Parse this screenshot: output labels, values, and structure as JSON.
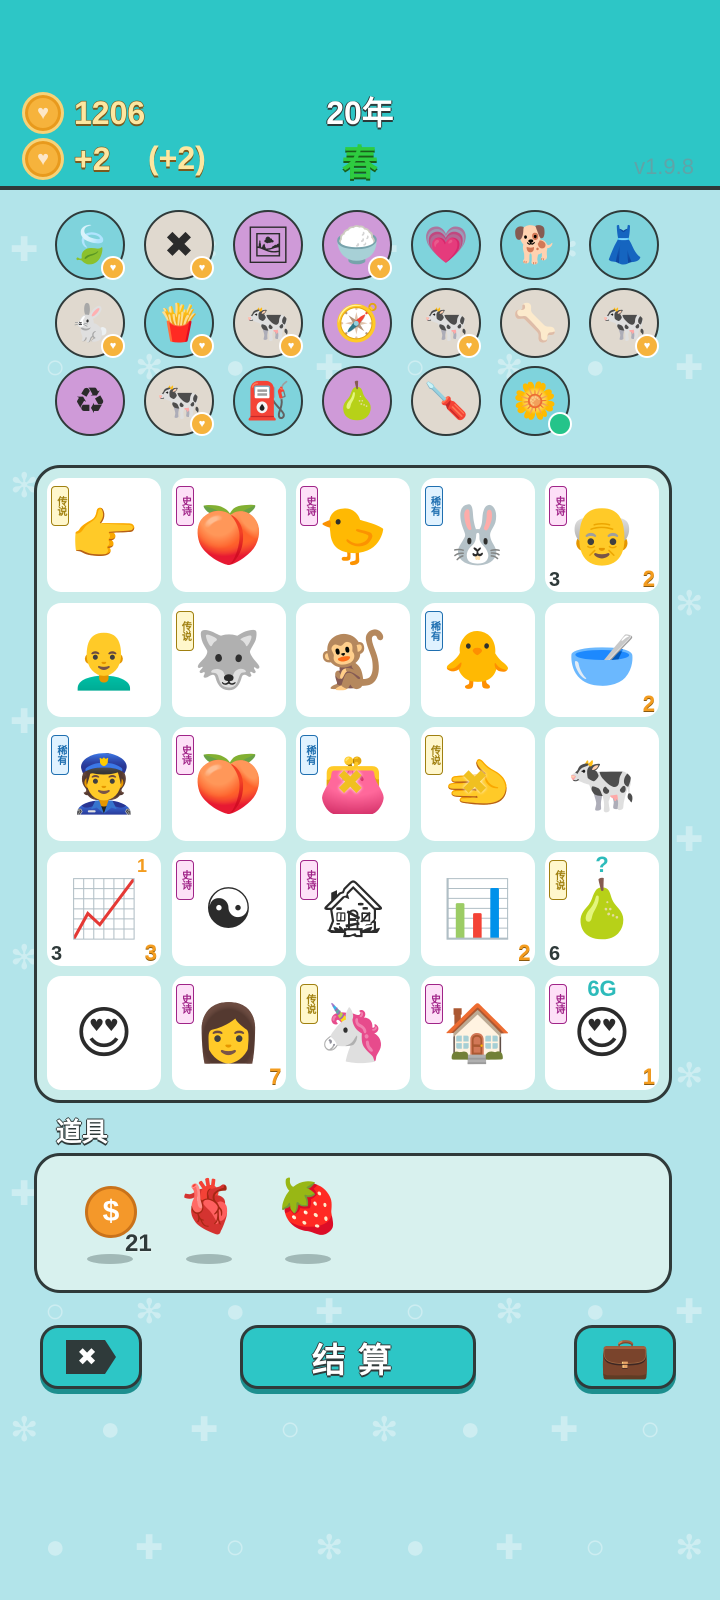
{
  "header": {
    "coins": "1206",
    "income": "+2",
    "income_bonus": "(+2)",
    "year": "20年",
    "season": "春",
    "version": "v1.9.8"
  },
  "relics": [
    {
      "icon": "leaf-icon",
      "glyph": "🍃",
      "bg": "#7fd3dc",
      "badge": true
    },
    {
      "icon": "delete-tag-icon",
      "glyph": "✖",
      "bg": "#e0d9cf",
      "badge": true
    },
    {
      "icon": "time-magazine-icon",
      "glyph": "🖼",
      "bg": "#cf9ad8",
      "badge": false
    },
    {
      "icon": "rice-bowl-icon",
      "glyph": "🍚",
      "bg": "#cf9ad8",
      "badge": true
    },
    {
      "icon": "heart-fan-icon",
      "glyph": "💗",
      "bg": "#7fd3dc",
      "badge": false
    },
    {
      "icon": "cool-dog-icon",
      "glyph": "🐕",
      "bg": "#7fd3dc",
      "badge": false
    },
    {
      "icon": "skirt-icon",
      "glyph": "👗",
      "bg": "#7fd3dc",
      "badge": false
    },
    {
      "icon": "rabbit-icon",
      "glyph": "🐇",
      "bg": "#e0d9cf",
      "badge": true
    },
    {
      "icon": "fries-icon",
      "glyph": "🍟",
      "bg": "#7fd3dc",
      "badge": true
    },
    {
      "icon": "cow-pair-icon",
      "glyph": "🐄",
      "bg": "#e0d9cf",
      "badge": true
    },
    {
      "icon": "compass-icon",
      "glyph": "🧭",
      "bg": "#cf9ad8",
      "badge": false
    },
    {
      "icon": "cow-pair-icon",
      "glyph": "🐄",
      "bg": "#e0d9cf",
      "badge": true
    },
    {
      "icon": "dog-bowl-icon",
      "glyph": "🦴",
      "bg": "#e0d9cf",
      "badge": false
    },
    {
      "icon": "cow-pair-icon",
      "glyph": "🐄",
      "bg": "#e0d9cf",
      "badge": true
    },
    {
      "icon": "recycle-icon",
      "glyph": "♻",
      "bg": "#cf9ad8",
      "badge": false
    },
    {
      "icon": "cow-pair-icon",
      "glyph": "🐄",
      "bg": "#e0d9cf",
      "badge": true
    },
    {
      "icon": "air-pump-icon",
      "glyph": "⛽",
      "bg": "#7fd3dc",
      "badge": false
    },
    {
      "icon": "pear-fruit-icon",
      "glyph": "🍐",
      "bg": "#cf9ad8",
      "badge": false
    },
    {
      "icon": "screwdriver-icon",
      "glyph": "🪛",
      "bg": "#e0d9cf",
      "badge": false
    },
    {
      "icon": "flower-pot-icon",
      "glyph": "🌼",
      "bg": "#7fd3dc",
      "badge": false,
      "dot": true
    }
  ],
  "rarity_labels": {
    "legend": "传说",
    "epic": "史诗",
    "rare": "稀有"
  },
  "board": [
    {
      "icon": "pointing-hand-icon",
      "glyph": "👉",
      "tag": "legend"
    },
    {
      "icon": "peach-icon",
      "glyph": "🍑",
      "tag": "epic"
    },
    {
      "icon": "yellow-chick-face-icon",
      "glyph": "🐤",
      "tag": "epic"
    },
    {
      "icon": "rabbit-icon",
      "glyph": "🐰",
      "tag": "rare"
    },
    {
      "icon": "grandpa-icon",
      "glyph": "👴",
      "tag": "epic",
      "bl": "3",
      "br": "2"
    },
    {
      "icon": "bald-man-icon",
      "glyph": "👨‍🦲",
      "tag": ""
    },
    {
      "icon": "husky-king-icon",
      "glyph": "🐺",
      "tag": "legend"
    },
    {
      "icon": "monkey-icon",
      "glyph": "🐒",
      "tag": ""
    },
    {
      "icon": "chick-icon",
      "glyph": "🐥",
      "tag": "rare"
    },
    {
      "icon": "soup-bowl-icon",
      "glyph": "🥣",
      "tag": "",
      "br": "2"
    },
    {
      "icon": "police-officer-icon",
      "glyph": "👮",
      "tag": "rare"
    },
    {
      "icon": "peach-icon",
      "glyph": "🍑",
      "tag": "epic"
    },
    {
      "icon": "broken-wallet-icon",
      "glyph": "👛",
      "tag": "rare",
      "mark": "✖"
    },
    {
      "icon": "golden-hand-icon",
      "glyph": "🫲",
      "tag": "legend",
      "mark": "✖"
    },
    {
      "icon": "cow-icon",
      "glyph": "🐄",
      "tag": ""
    },
    {
      "icon": "growth-card-icon",
      "glyph": "📈",
      "tag": "",
      "bl": "3",
      "br": "3",
      "top": "1"
    },
    {
      "icon": "bagua-watermelon-icon",
      "glyph": "☯",
      "tag": "epic"
    },
    {
      "icon": "haunted-house-icon",
      "glyph": "🏚",
      "tag": "epic"
    },
    {
      "icon": "bar-chart-icon",
      "glyph": "📊",
      "tag": "",
      "br": "2"
    },
    {
      "icon": "pear-icon",
      "glyph": "🍐",
      "tag": "legend",
      "bl": "6",
      "topc": "?"
    },
    {
      "icon": "love-grandpa-icon",
      "glyph": "😍",
      "tag": ""
    },
    {
      "icon": "girl-with-hearts-icon",
      "glyph": "👩",
      "tag": "epic",
      "br": "7"
    },
    {
      "icon": "unicorn-icon",
      "glyph": "🦄",
      "tag": "legend"
    },
    {
      "icon": "rabbit-house-icon",
      "glyph": "🏠",
      "tag": "epic"
    },
    {
      "icon": "love-face-6g-icon",
      "glyph": "😍",
      "tag": "epic",
      "br": "1",
      "topc": "6G"
    }
  ],
  "items": {
    "title": "道具",
    "list": [
      {
        "icon": "coin-item-icon",
        "glyph": "$",
        "count": "21"
      },
      {
        "icon": "liver-icon",
        "glyph": "🫀",
        "count": ""
      },
      {
        "icon": "strawberry-icon",
        "glyph": "🍓",
        "count": ""
      }
    ]
  },
  "buttons": {
    "settle": "结算",
    "delete_glyph": "✖",
    "bag_glyph": "💼"
  },
  "colors": {
    "header": "#2dc6c6",
    "background": "#b2e4ea",
    "legend": "#d9b630",
    "epic": "#c23aa6",
    "rare": "#2a8bd0"
  }
}
